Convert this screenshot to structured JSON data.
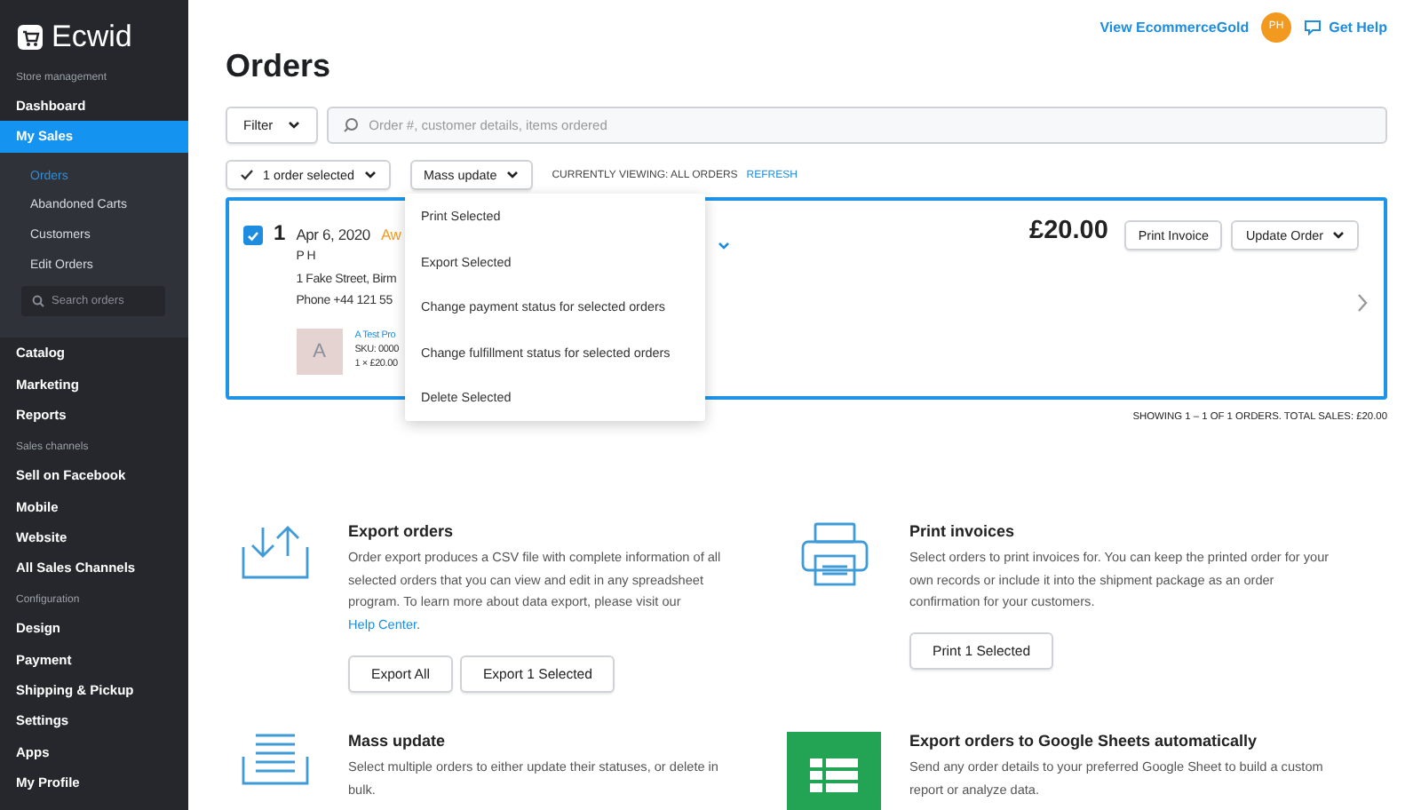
{
  "sidebar": {
    "logo": "Ecwid",
    "sections": [
      {
        "heading": "Store management",
        "items": [
          {
            "label": "Dashboard",
            "selected": false
          },
          {
            "label": "My Sales",
            "selected": true,
            "expanded": true,
            "children": [
              {
                "label": "Orders",
                "selected": true
              },
              {
                "label": "Abandoned Carts",
                "selected": false
              },
              {
                "label": "Customers",
                "selected": false
              },
              {
                "label": "Edit Orders",
                "selected": false
              }
            ],
            "search_placeholder": "Search orders"
          },
          {
            "label": "Catalog",
            "selected": false
          },
          {
            "label": "Marketing",
            "selected": false
          },
          {
            "label": "Reports",
            "selected": false
          }
        ]
      },
      {
        "heading": "Sales channels",
        "items": [
          {
            "label": "Sell on Facebook",
            "selected": false
          },
          {
            "label": "Mobile",
            "selected": false
          },
          {
            "label": "Website",
            "selected": false
          },
          {
            "label": "All Sales Channels",
            "selected": false
          }
        ]
      },
      {
        "heading": "Configuration",
        "items": [
          {
            "label": "Design",
            "selected": false
          },
          {
            "label": "Payment",
            "selected": false
          },
          {
            "label": "Shipping & Pickup",
            "selected": false
          },
          {
            "label": "Settings",
            "selected": false
          },
          {
            "label": "Apps",
            "selected": false
          },
          {
            "label": "My Profile",
            "selected": false
          }
        ]
      }
    ]
  },
  "header": {
    "store_link": "View EcommerceGold",
    "avatar": "PH",
    "help": "Get Help"
  },
  "page_title": "Orders",
  "filter": {
    "label": "Filter",
    "search_placeholder": "Order #, customer details, items ordered"
  },
  "selection": {
    "label": "1 order selected",
    "checked": true,
    "mass_update": "Mass update",
    "viewing": "CURRENTLY VIEWING: ALL ORDERS",
    "refresh": "REFRESH"
  },
  "mass_update_menu": {
    "open": true,
    "items": [
      "Print Selected",
      "Export Selected",
      "Change payment status for selected orders",
      "Change fulfillment status for selected orders",
      "Delete Selected"
    ]
  },
  "orders": [
    {
      "selected": true,
      "number": "1",
      "date": "Apr 6, 2020",
      "status": "Aw",
      "customer": "P H",
      "address": "1 Fake Street, Birm",
      "phone": "Phone +44 121 55",
      "product": {
        "thumb": "A",
        "name": "A Test Pro",
        "sku": "SKU: 0000",
        "quantity": "1 × £20.00"
      },
      "total": "£20.00",
      "buttons": [
        "Print Invoice",
        "Update Order"
      ]
    }
  ],
  "summary": "SHOWING 1 – 1 OF 1 ORDERS. TOTAL SALES: £20.00",
  "tools": [
    {
      "kind": "export",
      "title": "Export orders",
      "description": "Order export produces a CSV file with complete information of all selected orders that you can view and edit in any spreadsheet program. To learn more about data export, please visit our ",
      "link": "Help Center",
      "after_link": ".",
      "buttons": [
        "Export All",
        "Export 1 Selected"
      ]
    },
    {
      "kind": "print",
      "title": "Print invoices",
      "description": "Select orders to print invoices for. You can keep the printed order for your own records or include it into the shipment package as an order confirmation for your customers.",
      "buttons": [
        "Print 1 Selected"
      ]
    },
    {
      "kind": "mass",
      "title": "Mass update",
      "description": "Select multiple orders to either update their statuses, or delete in bulk."
    },
    {
      "kind": "sheets",
      "title": "Export orders to Google Sheets automatically",
      "description": "Send any order details to your preferred Google Sheet to build a custom report or analyze data."
    }
  ]
}
